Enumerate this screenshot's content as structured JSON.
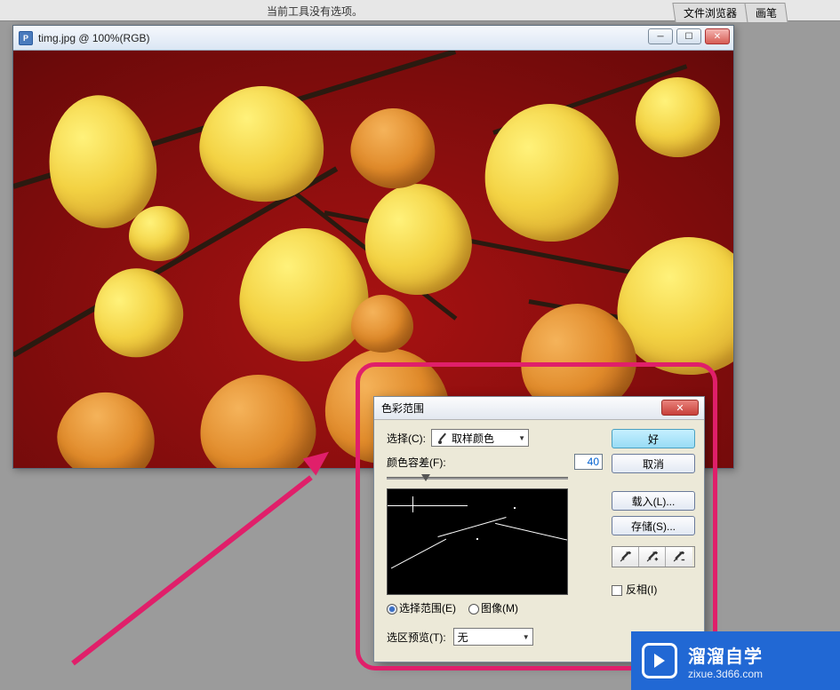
{
  "top": {
    "options_text": "当前工具没有选项。",
    "tabs": [
      "文件浏览器",
      "画笔"
    ]
  },
  "doc": {
    "title": "timg.jpg @ 100%(RGB)"
  },
  "dialog": {
    "title": "色彩范围",
    "select_label": "选择(C):",
    "select_value": "取样颜色",
    "fuzziness_label": "颜色容差(F):",
    "fuzziness_value": "40",
    "slider_pos_pct": 19,
    "radio_selection": "选择范围(E)",
    "radio_image": "图像(M)",
    "preview_label": "选区预览(T):",
    "preview_value": "无",
    "buttons": {
      "ok": "好",
      "cancel": "取消",
      "load": "载入(L)...",
      "save": "存储(S)..."
    },
    "invert_label": "反相(I)"
  },
  "watermark": {
    "brand": "溜溜自学",
    "domain": "zixue.3d66.com"
  }
}
